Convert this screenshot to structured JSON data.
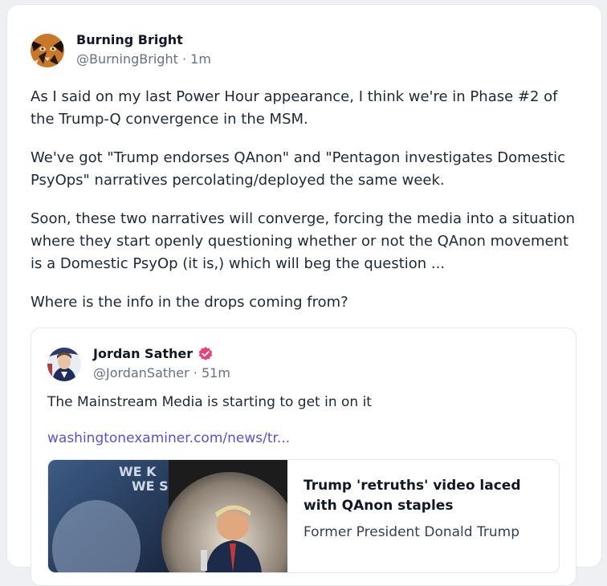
{
  "post": {
    "author": {
      "display_name": "Burning Bright",
      "handle": "@BurningBright",
      "time": "1m"
    },
    "paragraphs": [
      "As I said on my last Power Hour appearance, I think we're in Phase #2 of the Trump-Q convergence in the MSM.",
      "We've got \"Trump endorses QAnon\" and \"Pentagon investigates Domestic PsyOps\" narratives percolating/deployed the same week.",
      "Soon, these two narratives will converge, forcing the media into a situation where they start openly questioning whether or not the QAnon movement is a Domestic PsyOp (it is,) which will beg the question ...",
      "Where is the info in the drops coming from?"
    ],
    "separator": "·"
  },
  "quoted_post": {
    "author": {
      "display_name": "Jordan Sather",
      "handle": "@JordanSather",
      "time": "51m",
      "verified_icon": "verified-badge-icon"
    },
    "text": "The Mainstream Media is starting to get in on it",
    "link_text": "washingtonexaminer.com/news/tr...",
    "link_card": {
      "image_text": "WE K\nWE S",
      "title": "Trump 'retruths' video laced with QAnon staples",
      "description": "Former President Donald Trump"
    }
  },
  "colors": {
    "link": "#5b4fd6",
    "verified": "#e8437a",
    "muted": "#667085"
  }
}
